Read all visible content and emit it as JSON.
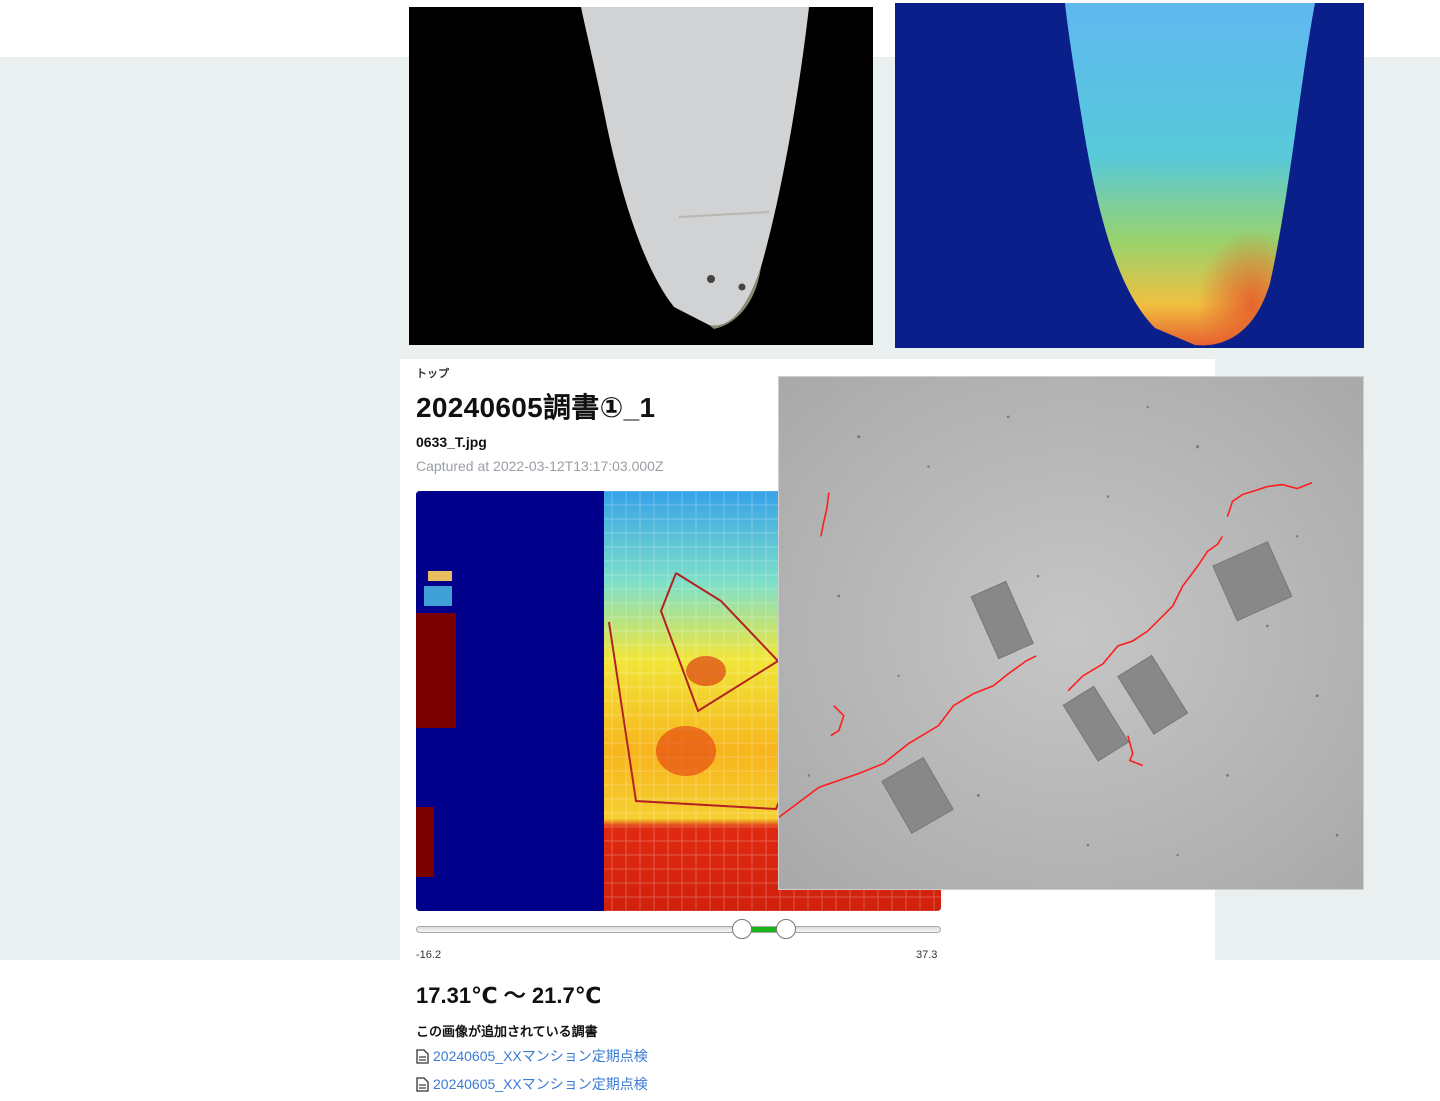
{
  "breadcrumb": "トップ",
  "title": "20240605調書①_1",
  "image": {
    "filename": "0633_T.jpg",
    "captured": "Captured at 2022-03-12T13:17:03.000Z"
  },
  "range_slider": {
    "min_label": "-16.2",
    "max_label": "37.3",
    "min": -16.2,
    "max": 37.3,
    "low": 17.31,
    "high": 21.7
  },
  "temperature_range": "17.31℃ ～ 21.7℃",
  "reports": {
    "heading": "この画像が追加されている調書",
    "items": [
      {
        "label": "20240605_XXマンション定期点検"
      },
      {
        "label": "20240605_XXマンション定期点検"
      }
    ]
  },
  "colors": {
    "link": "#3a7bd5",
    "range_fill": "#17b317",
    "page_band": "#eaf0ef"
  },
  "icons": [
    "document-icon"
  ]
}
